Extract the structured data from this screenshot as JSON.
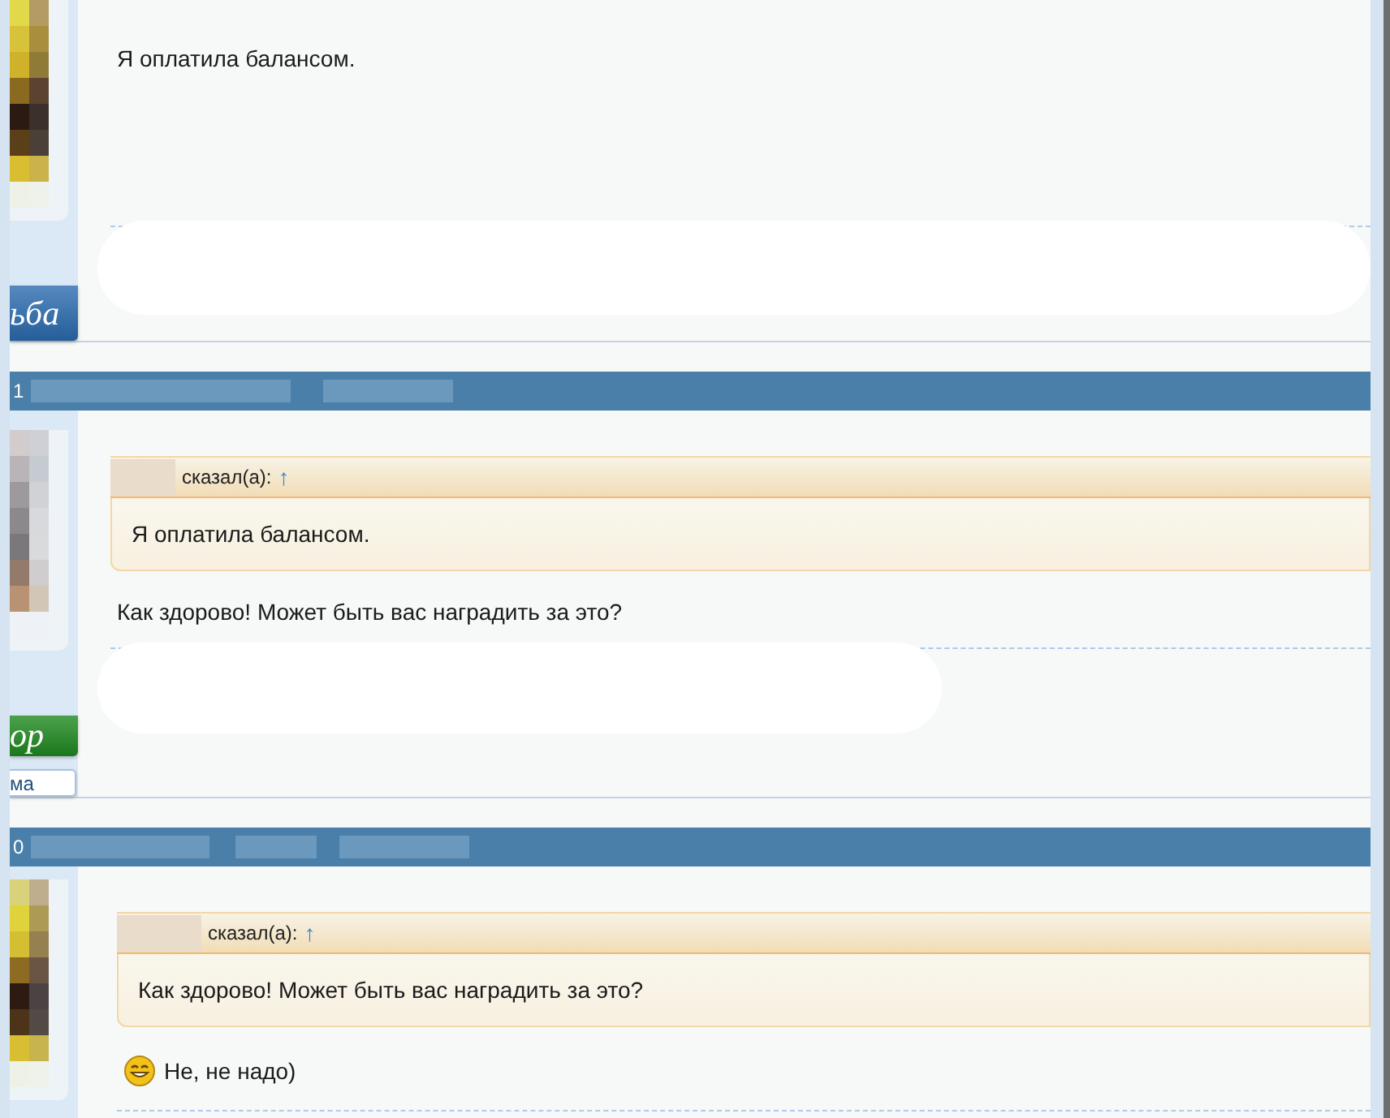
{
  "posts": [
    {
      "rank_badge": {
        "label": "ьба",
        "color": "#2b6cb0"
      },
      "message": "Я оплатила балансом.",
      "emoticon": false
    },
    {
      "header_number": "1",
      "rank_badge": {
        "label": "ор",
        "color": "#1f8a1f"
      },
      "rank_title": "ма",
      "quote": {
        "said": "сказал(а):",
        "link": "↑",
        "text": "Я оплатила балансом."
      },
      "message": "Как здорово! Может быть вас наградить за это?",
      "emoticon": false
    },
    {
      "header_number": "0",
      "quote": {
        "said": "сказал(а):",
        "link": "↑",
        "text": "Как здорово! Может быть вас наградить за это?"
      },
      "message": "Не, не надо)",
      "emoticon": true
    }
  ]
}
